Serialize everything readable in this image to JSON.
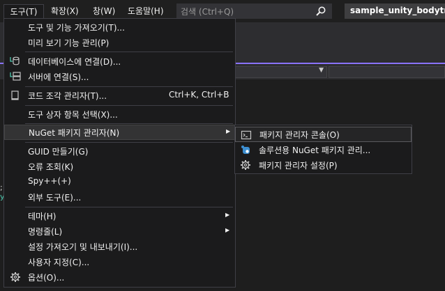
{
  "menubar": {
    "items": [
      "도구(T)",
      "확장(X)",
      "창(W)",
      "도움말(H)"
    ],
    "search_placeholder": "검색 (Ctrl+Q)",
    "project_name": "sample_unity_bodytrack"
  },
  "background": {
    "code_fragments": [
      ";",
      "y"
    ]
  },
  "tools_menu": {
    "items": [
      {
        "label": "도구 및 기능 가져오기(T)..."
      },
      {
        "label": "미리 보기 기능 관리(P)"
      },
      {
        "label": "데이터베이스에 연결(D)...",
        "icon": "database-connect-icon"
      },
      {
        "label": "서버에 연결(S)...",
        "icon": "server-connect-icon"
      },
      {
        "label": "코드 조각 관리자(T)...",
        "shortcut": "Ctrl+K, Ctrl+B",
        "icon": "code-snippet-icon"
      },
      {
        "label": "도구 상자 항목 선택(X)..."
      },
      {
        "label": "NuGet 패키지 관리자(N)"
      },
      {
        "label": "GUID 만들기(G)"
      },
      {
        "label": "오류 조회(K)"
      },
      {
        "label": "Spy++(+)"
      },
      {
        "label": "외부 도구(E)..."
      },
      {
        "label": "테마(H)"
      },
      {
        "label": "명령줄(L)"
      },
      {
        "label": "설정 가져오기 및 내보내기(I)..."
      },
      {
        "label": "사용자 지정(C)..."
      },
      {
        "label": "옵션(O)...",
        "icon": "gear-icon"
      }
    ]
  },
  "nuget_submenu": {
    "items": [
      {
        "label": "패키지 관리자 콘솔(O)",
        "icon": "console-icon"
      },
      {
        "label": "솔루션용 NuGet 패키지 관리...",
        "icon": "nuget-icon"
      },
      {
        "label": "패키지 관리자 설정(P)",
        "icon": "gear-icon"
      }
    ]
  },
  "colors": {
    "accent": "#8a73ff",
    "menu_bg": "#1b1b1c",
    "highlight_bg": "#333334"
  }
}
